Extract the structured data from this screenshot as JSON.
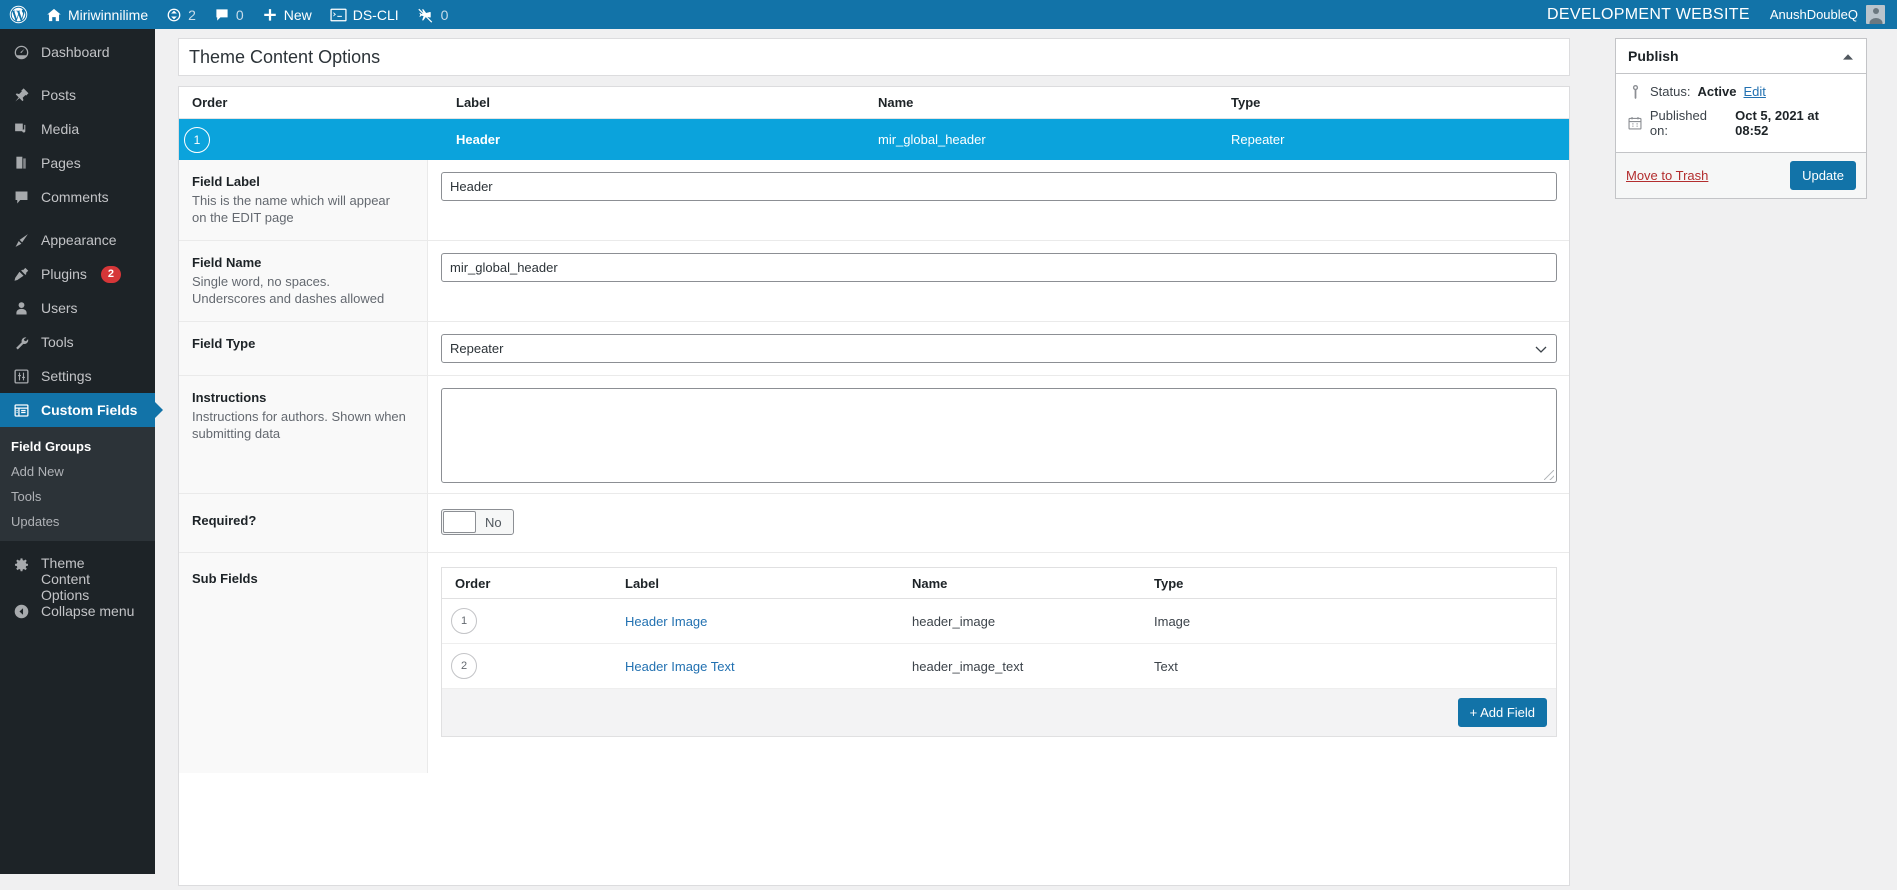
{
  "adminbar": {
    "wp_logo": "wordpress-logo-icon",
    "site_name": "Miriwinnilime",
    "updates_count": "2",
    "comments_count": "0",
    "new_label": "New",
    "dscli_label": "DS-CLI",
    "flights_count": "0",
    "dev_site": "DEVELOPMENT WEBSITE",
    "user_name": "AnushDoubleQ"
  },
  "sidebar": {
    "items": [
      {
        "label": "Dashboard",
        "icon": "dashboard-icon"
      },
      {
        "label": "Posts",
        "icon": "pin-icon"
      },
      {
        "label": "Media",
        "icon": "media-icon"
      },
      {
        "label": "Pages",
        "icon": "pages-icon"
      },
      {
        "label": "Comments",
        "icon": "comment-icon"
      },
      {
        "label": "Appearance",
        "icon": "brush-icon"
      },
      {
        "label": "Plugins",
        "icon": "plug-icon",
        "badge": "2"
      },
      {
        "label": "Users",
        "icon": "user-icon"
      },
      {
        "label": "Tools",
        "icon": "wrench-icon"
      },
      {
        "label": "Settings",
        "icon": "sliders-icon"
      },
      {
        "label": "Custom Fields",
        "icon": "custom-fields-icon",
        "current": true
      },
      {
        "label": "Theme Content Options",
        "icon": "gear-icon"
      },
      {
        "label": "Collapse menu",
        "icon": "collapse-arrow-icon"
      }
    ],
    "submenu": [
      {
        "label": "Field Groups",
        "current": true
      },
      {
        "label": "Add New"
      },
      {
        "label": "Tools"
      },
      {
        "label": "Updates"
      }
    ]
  },
  "main": {
    "page_title": "Theme Content Options",
    "columns": {
      "order": "Order",
      "label": "Label",
      "name": "Name",
      "type": "Type"
    },
    "active_field": {
      "order": "1",
      "label": "Header",
      "name": "mir_global_header",
      "type": "Repeater"
    },
    "settings": {
      "field_label": {
        "title": "Field Label",
        "desc": "This is the name which will appear on the EDIT page",
        "value": "Header"
      },
      "field_name": {
        "title": "Field Name",
        "desc": "Single word, no spaces. Underscores and dashes allowed",
        "value": "mir_global_header"
      },
      "field_type": {
        "title": "Field Type",
        "value": "Repeater"
      },
      "instructions": {
        "title": "Instructions",
        "desc": "Instructions for authors. Shown when submitting data",
        "value": ""
      },
      "required": {
        "title": "Required?",
        "toggle_label": "No"
      },
      "sub_fields": {
        "title": "Sub Fields",
        "columns": {
          "order": "Order",
          "label": "Label",
          "name": "Name",
          "type": "Type"
        },
        "rows": [
          {
            "order": "1",
            "label": "Header Image",
            "name": "header_image",
            "type": "Image"
          },
          {
            "order": "2",
            "label": "Header Image Text",
            "name": "header_image_text",
            "type": "Text"
          }
        ],
        "add_field_label": "+ Add Field"
      }
    }
  },
  "publish": {
    "title": "Publish",
    "collapse_icon": "chevron-up-icon",
    "status_prefix": "Status:",
    "status_value": "Active",
    "status_edit": "Edit",
    "published_prefix": "Published on:",
    "published_value": "Oct 5, 2021 at 08:52",
    "trash_label": "Move to Trash",
    "update_label": "Update"
  },
  "colors": {
    "admin_blue": "#1273a8",
    "row_active": "#0ba3dc",
    "sidebar_bg": "#1d2327",
    "link": "#2271b1",
    "danger": "#b32d2e"
  }
}
